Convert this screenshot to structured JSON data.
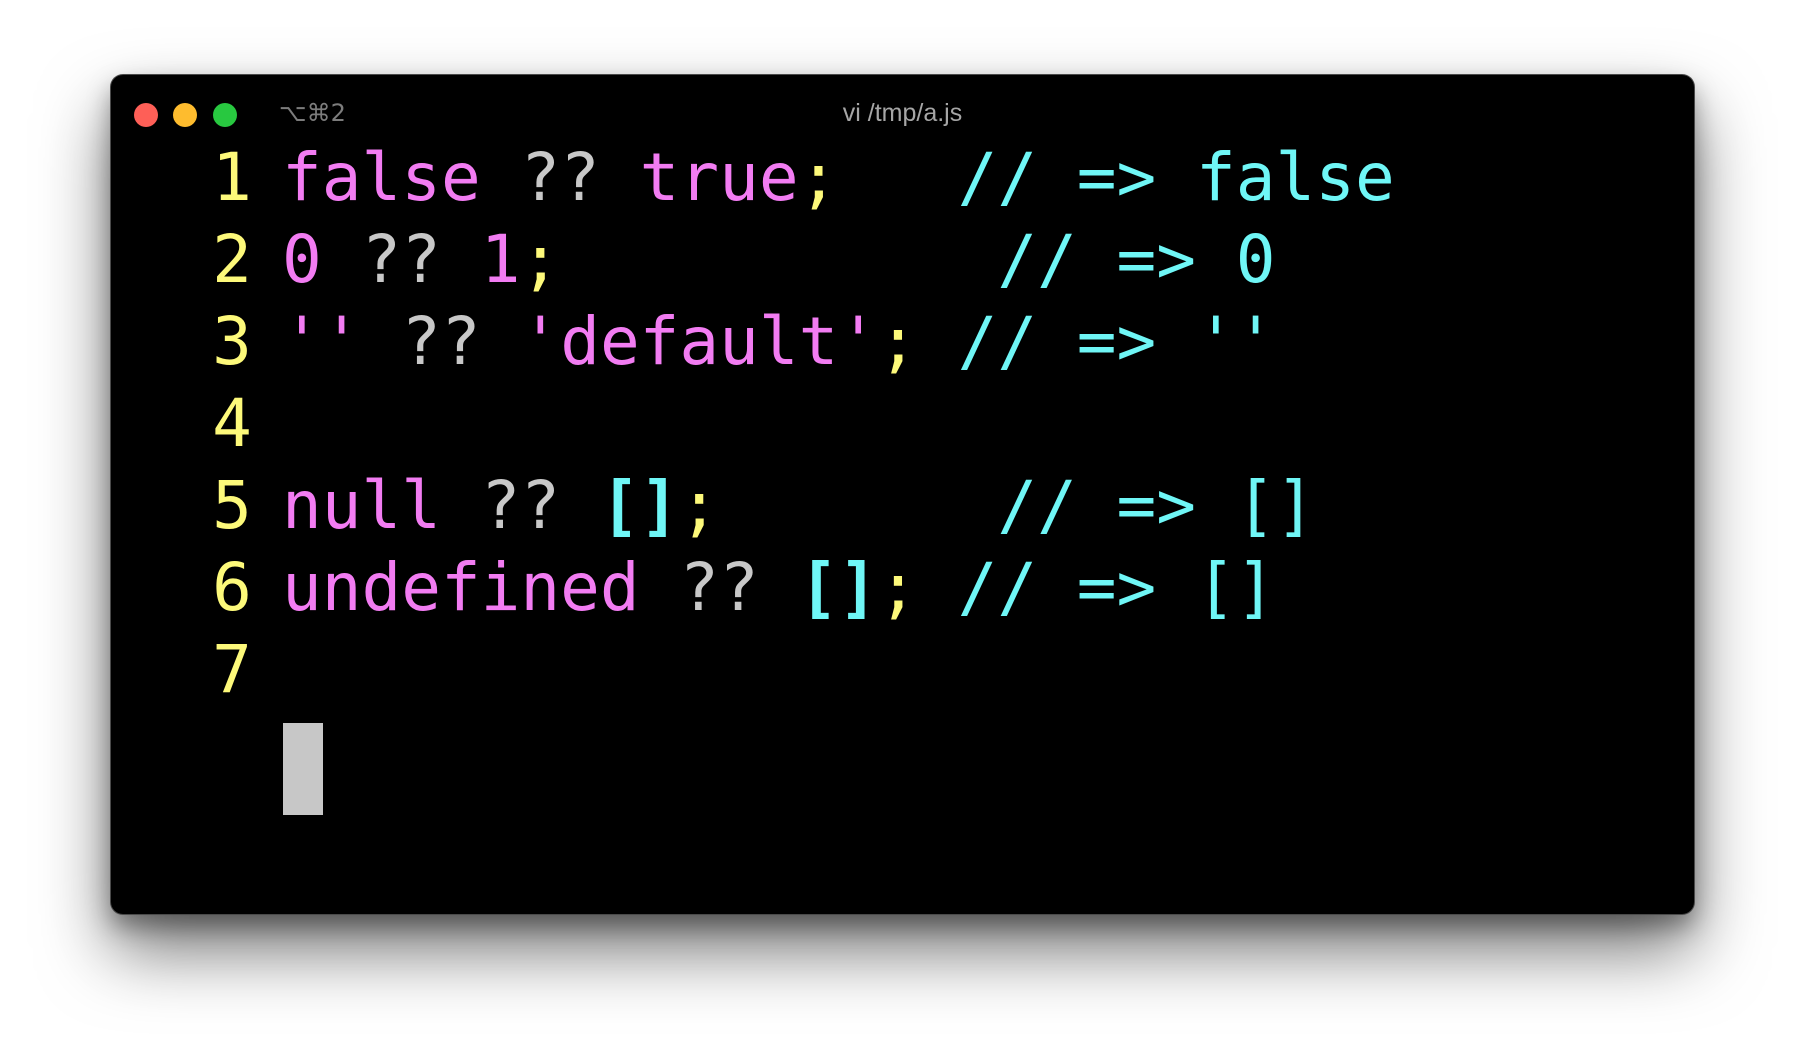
{
  "window": {
    "shortcut": "⌥⌘2",
    "title": "vi /tmp/a.js"
  },
  "colors": {
    "background": "#000000",
    "line_number": "#fdf97a",
    "keyword": "#f27cf2",
    "operator": "#c8c8c8",
    "punctuation": "#fdf97a",
    "comment": "#6ff6f6",
    "bracket": "#6ff6f6",
    "cursor": "#c7c7c7",
    "traffic_close": "#fe5f57",
    "traffic_minimize": "#febc2e",
    "traffic_zoom": "#28c840"
  },
  "editor": {
    "lines": [
      {
        "number": "1",
        "tokens": [
          {
            "text": "false",
            "kind": "keyword"
          },
          {
            "text": " ",
            "kind": "space"
          },
          {
            "text": "??",
            "kind": "operator"
          },
          {
            "text": " ",
            "kind": "space"
          },
          {
            "text": "true",
            "kind": "keyword"
          },
          {
            "text": ";",
            "kind": "punctuation"
          },
          {
            "text": "   ",
            "kind": "space"
          },
          {
            "text": "// => false",
            "kind": "comment"
          }
        ]
      },
      {
        "number": "2",
        "tokens": [
          {
            "text": "0",
            "kind": "keyword"
          },
          {
            "text": " ",
            "kind": "space"
          },
          {
            "text": "??",
            "kind": "operator"
          },
          {
            "text": " ",
            "kind": "space"
          },
          {
            "text": "1",
            "kind": "keyword"
          },
          {
            "text": ";",
            "kind": "punctuation"
          },
          {
            "text": "           ",
            "kind": "space"
          },
          {
            "text": "// => 0",
            "kind": "comment"
          }
        ]
      },
      {
        "number": "3",
        "tokens": [
          {
            "text": "''",
            "kind": "keyword"
          },
          {
            "text": " ",
            "kind": "space"
          },
          {
            "text": "??",
            "kind": "operator"
          },
          {
            "text": " ",
            "kind": "space"
          },
          {
            "text": "'default'",
            "kind": "keyword"
          },
          {
            "text": ";",
            "kind": "punctuation"
          },
          {
            "text": " ",
            "kind": "space"
          },
          {
            "text": "// => ''",
            "kind": "comment"
          }
        ]
      },
      {
        "number": "4",
        "tokens": []
      },
      {
        "number": "5",
        "tokens": [
          {
            "text": "null",
            "kind": "keyword"
          },
          {
            "text": " ",
            "kind": "space"
          },
          {
            "text": "??",
            "kind": "operator"
          },
          {
            "text": " ",
            "kind": "space"
          },
          {
            "text": "[]",
            "kind": "bracket"
          },
          {
            "text": ";",
            "kind": "punctuation"
          },
          {
            "text": "       ",
            "kind": "space"
          },
          {
            "text": "// => []",
            "kind": "comment"
          }
        ]
      },
      {
        "number": "6",
        "tokens": [
          {
            "text": "undefined",
            "kind": "keyword"
          },
          {
            "text": " ",
            "kind": "space"
          },
          {
            "text": "??",
            "kind": "operator"
          },
          {
            "text": " ",
            "kind": "space"
          },
          {
            "text": "[]",
            "kind": "bracket"
          },
          {
            "text": ";",
            "kind": "punctuation"
          },
          {
            "text": " ",
            "kind": "space"
          },
          {
            "text": "// => []",
            "kind": "comment"
          }
        ]
      },
      {
        "number": "7",
        "tokens": []
      }
    ]
  }
}
